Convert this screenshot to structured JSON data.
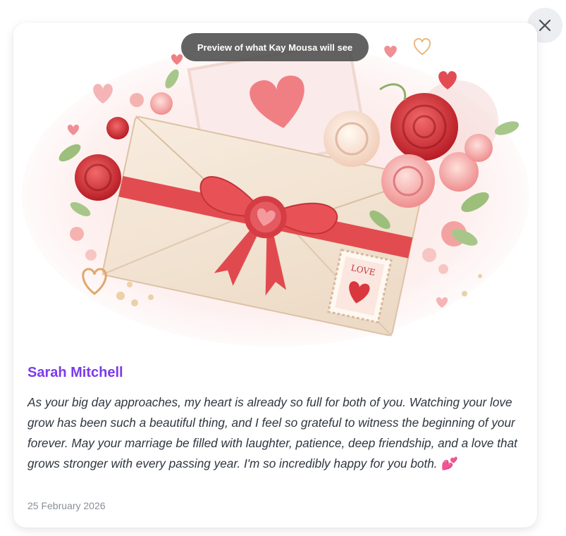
{
  "dialog": {
    "close_icon": "close-icon"
  },
  "card": {
    "preview_label": "Preview of what Kay Mousa will see",
    "image": {
      "description_icon": "love-letter-envelope-illustration",
      "stamp_text": "LOVE"
    },
    "sender_name": "Sarah Mitchell",
    "message": "As your big day approaches, my heart is already so full for both of you. Watching your love grow has been such a beautiful thing, and I feel so grateful to witness the beginning of your forever. May your marriage be filled with laughter, patience, deep friendship, and a love that grows stronger with every passing year. I'm so incredibly happy for you both. 💕",
    "date": "25 February 2026"
  },
  "colors": {
    "accent": "#7c3aed",
    "pill_bg": "#4c4c4c",
    "text": "#2f3640",
    "muted": "#8a8f98"
  }
}
